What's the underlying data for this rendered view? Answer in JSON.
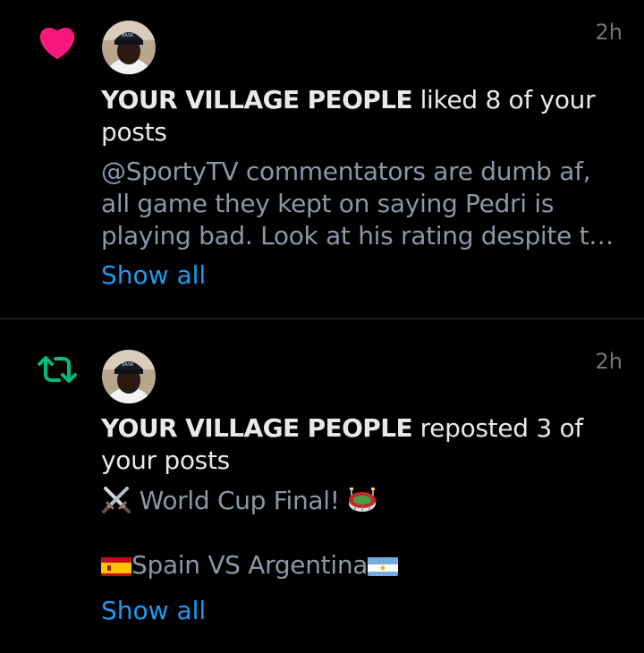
{
  "notifications": [
    {
      "type": "like",
      "icon": "heart-icon",
      "icon_color": "#f91880",
      "time": "2h",
      "user": "YOUR VILLAGE PEOPLE",
      "action": " liked 8 of your posts",
      "preview": "@SportyTV commentators are dumb af, all game they kept on saying Pedri is playing bad. Look at his rating despite the yellow card.",
      "show_all": "Show all"
    },
    {
      "type": "repost",
      "icon": "repost-icon",
      "icon_color": "#00ba7c",
      "time": "2h",
      "user": "YOUR VILLAGE PEOPLE",
      "action": " reposted 3 of your posts",
      "preview_line1": " World Cup Final! ",
      "preview_line2_a": "Spain VS Argentina",
      "show_all": "Show all"
    }
  ],
  "avatar_cap_text": "BASK",
  "colors": {
    "link": "#1d9bf0",
    "muted": "#8b98a5",
    "background": "#000000"
  }
}
